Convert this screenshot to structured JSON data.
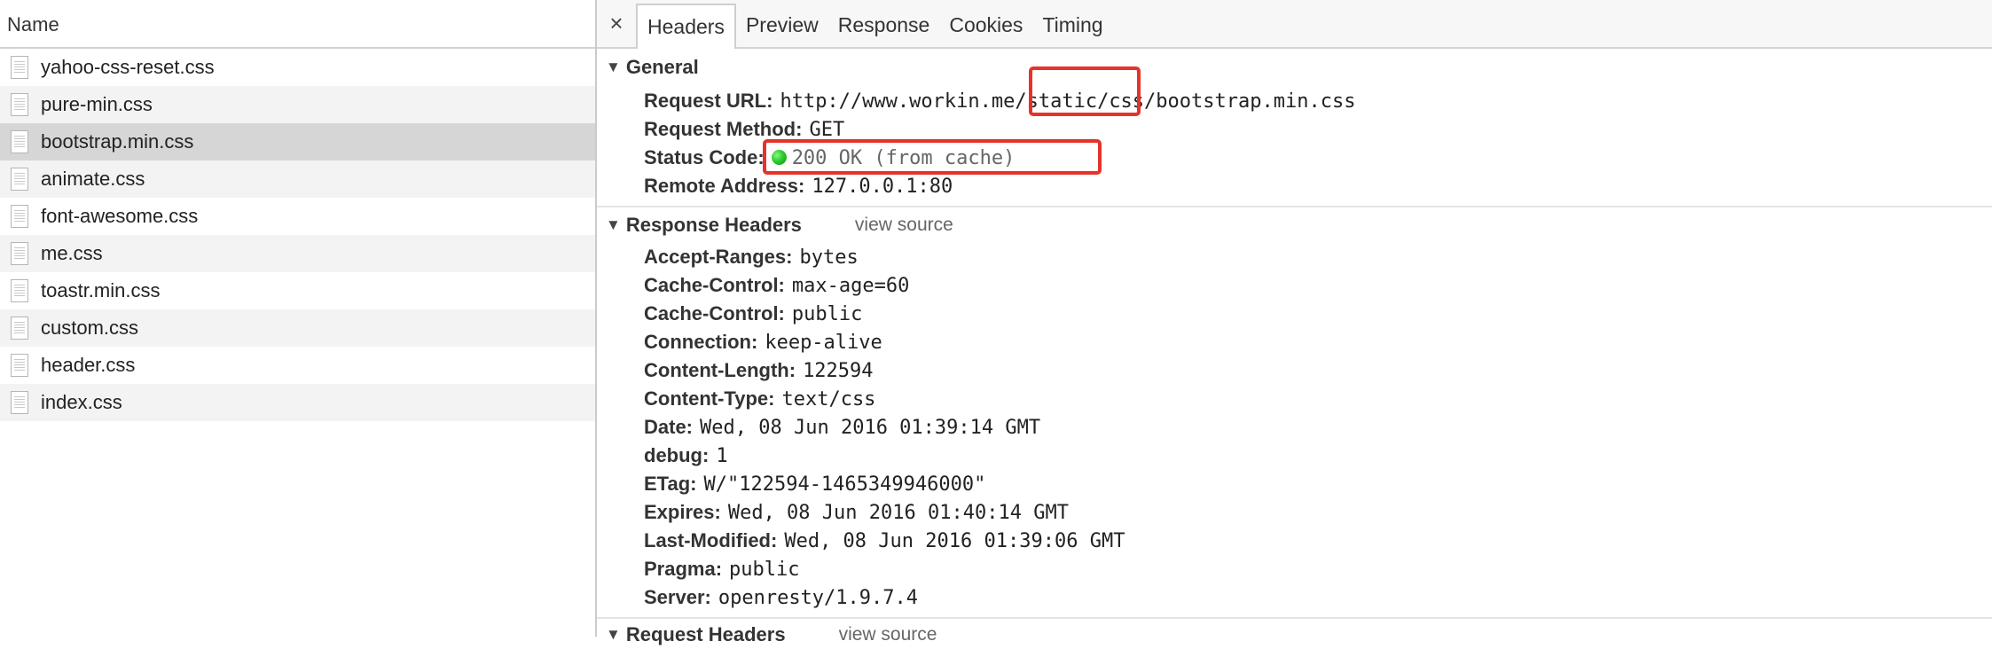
{
  "left_panel": {
    "header": "Name",
    "files": [
      {
        "name": "yahoo-css-reset.css"
      },
      {
        "name": "pure-min.css"
      },
      {
        "name": "bootstrap.min.css"
      },
      {
        "name": "animate.css"
      },
      {
        "name": "font-awesome.css"
      },
      {
        "name": "me.css"
      },
      {
        "name": "toastr.min.css"
      },
      {
        "name": "custom.css"
      },
      {
        "name": "header.css"
      },
      {
        "name": "index.css"
      }
    ],
    "selected_file": "bootstrap.min.css"
  },
  "tabs": {
    "close": "×",
    "items": [
      "Headers",
      "Preview",
      "Response",
      "Cookies",
      "Timing"
    ],
    "active": "Headers"
  },
  "general": {
    "title": "General",
    "request_url_label": "Request URL:",
    "request_url_value": "http://www.workin.me/static/css/bootstrap.min.css",
    "request_method_label": "Request Method:",
    "request_method_value": "GET",
    "status_code_label": "Status Code:",
    "status_code_value": "200 OK (from cache)",
    "status_color": "#2ccc2c",
    "remote_address_label": "Remote Address:",
    "remote_address_value": "127.0.0.1:80"
  },
  "response_headers": {
    "title": "Response Headers",
    "view_source": "view source",
    "items": [
      {
        "k": "Accept-Ranges:",
        "v": "bytes"
      },
      {
        "k": "Cache-Control:",
        "v": "max-age=60"
      },
      {
        "k": "Cache-Control:",
        "v": "public"
      },
      {
        "k": "Connection:",
        "v": "keep-alive"
      },
      {
        "k": "Content-Length:",
        "v": "122594"
      },
      {
        "k": "Content-Type:",
        "v": "text/css"
      },
      {
        "k": "Date:",
        "v": "Wed, 08 Jun 2016 01:39:14 GMT"
      },
      {
        "k": "debug:",
        "v": "1"
      },
      {
        "k": "ETag:",
        "v": "W/\"122594-1465349946000\""
      },
      {
        "k": "Expires:",
        "v": "Wed, 08 Jun 2016 01:40:14 GMT"
      },
      {
        "k": "Last-Modified:",
        "v": "Wed, 08 Jun 2016 01:39:06 GMT"
      },
      {
        "k": "Pragma:",
        "v": "public"
      },
      {
        "k": "Server:",
        "v": "openresty/1.9.7.4"
      }
    ]
  },
  "request_headers": {
    "title": "Request Headers",
    "view_source": "view source"
  },
  "annotation_color": "#e5332a"
}
